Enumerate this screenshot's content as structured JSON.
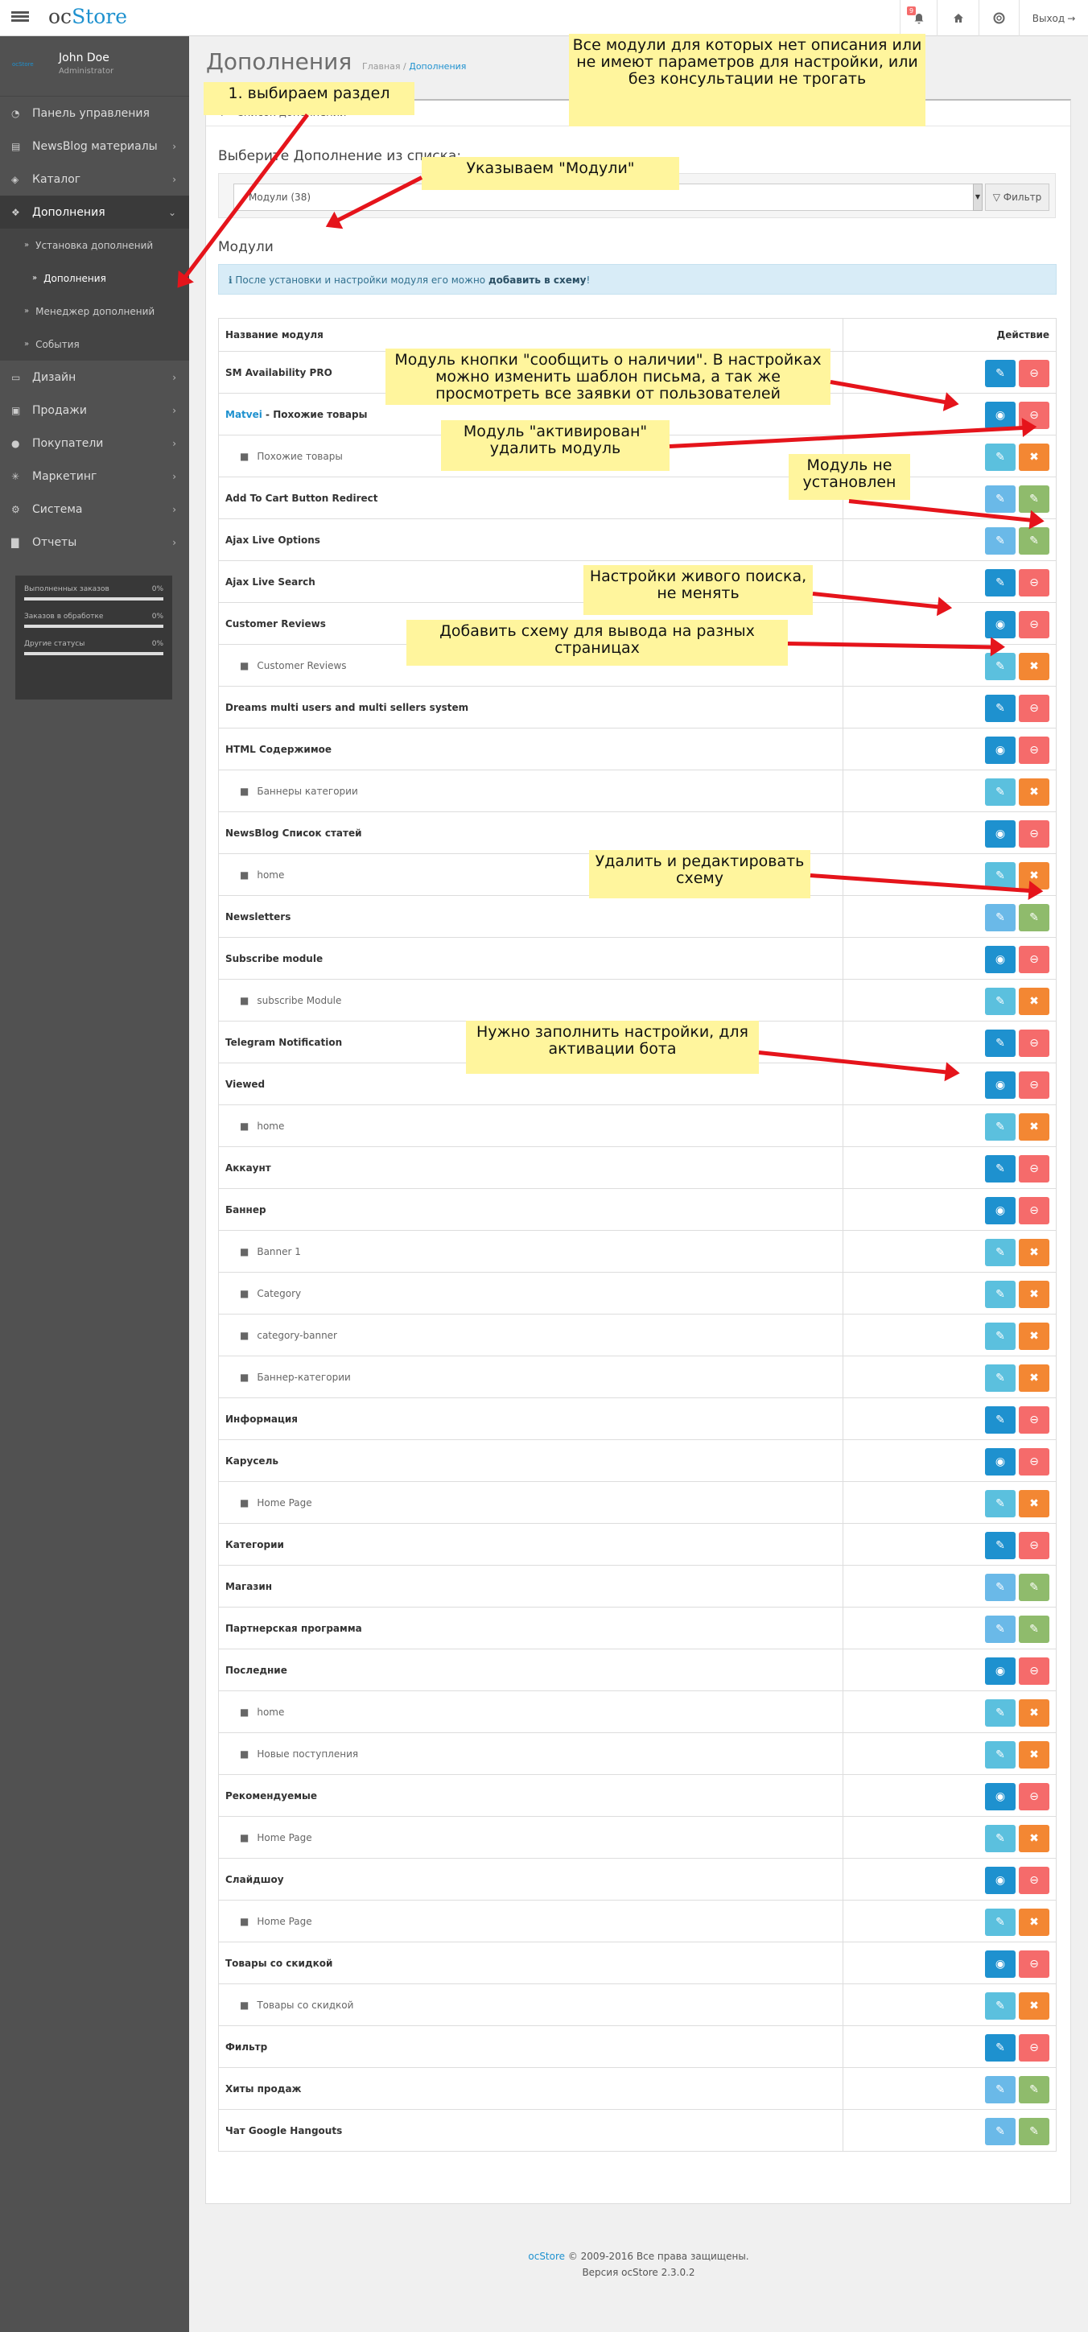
{
  "header": {
    "logo_prefix": "oc",
    "logo_name": "Store",
    "bell_badge": "9",
    "logout_label": "Выход"
  },
  "profile": {
    "avatar_text": "ocStore",
    "name": "John Doe",
    "role": "Administrator"
  },
  "sidebar": {
    "items": [
      {
        "label": "Панель управления",
        "icon": "dashboard-icon"
      },
      {
        "label": "NewsBlog материалы",
        "icon": "newspaper-icon"
      },
      {
        "label": "Каталог",
        "icon": "tag-icon"
      },
      {
        "label": "Дополнения",
        "icon": "puzzle-icon"
      },
      {
        "label": "Дизайн",
        "icon": "monitor-icon"
      },
      {
        "label": "Продажи",
        "icon": "cart-icon"
      },
      {
        "label": "Покупатели",
        "icon": "user-icon"
      },
      {
        "label": "Маркетинг",
        "icon": "share-icon"
      },
      {
        "label": "Система",
        "icon": "gear-icon"
      },
      {
        "label": "Отчеты",
        "icon": "bar-chart-icon"
      }
    ],
    "subitems": [
      {
        "label": "Установка дополнений"
      },
      {
        "label": "Дополнения"
      },
      {
        "label": "Менеджер дополнений"
      },
      {
        "label": "События"
      }
    ],
    "stats": [
      {
        "label": "Выполненных заказов",
        "value": "0%"
      },
      {
        "label": "Заказов в обработке",
        "value": "0%"
      },
      {
        "label": "Другие статусы",
        "value": "0%"
      }
    ]
  },
  "page": {
    "title": "Дополнения",
    "breadcrumb_home": "Главная",
    "breadcrumb_current": "Дополнения",
    "panel_title": "Список дополнений",
    "choose_label": "Выберите Дополнение из списка:",
    "select_value": "Модули (38)",
    "filter_label": "Фильтр",
    "modules_heading": "Модули",
    "info_text": "После установки и настройки модуля его можно ",
    "info_bold": "добавить в схему",
    "info_end": "!",
    "col_name": "Название модуля",
    "col_action": "Действие"
  },
  "rows": [
    {
      "name": "SM Availability PRO",
      "type": "module",
      "state": "installed-no-status"
    },
    {
      "prefix": "Matvei",
      "name": " - Похожие товары",
      "type": "module",
      "state": "installed"
    },
    {
      "name": "Похожие товары",
      "type": "sub"
    },
    {
      "name": "Add To Cart Button Redirect",
      "type": "module",
      "state": "not-installed"
    },
    {
      "name": "Ajax Live Options",
      "type": "module",
      "state": "not-installed"
    },
    {
      "name": "Ajax Live Search",
      "type": "module",
      "state": "installed-no-status"
    },
    {
      "name": "Customer Reviews",
      "type": "module",
      "state": "installed"
    },
    {
      "name": "Customer Reviews",
      "type": "sub"
    },
    {
      "name": "Dreams multi users and multi sellers system",
      "type": "module",
      "state": "installed-no-status"
    },
    {
      "name": "HTML Содержимое",
      "type": "module",
      "state": "installed"
    },
    {
      "name": "Баннеры категории",
      "type": "sub"
    },
    {
      "name": "NewsBlog Список статей",
      "type": "module",
      "state": "installed"
    },
    {
      "name": "home",
      "type": "sub"
    },
    {
      "name": "Newsletters",
      "type": "module",
      "state": "not-installed"
    },
    {
      "name": "Subscribe module",
      "type": "module",
      "state": "installed"
    },
    {
      "name": "subscribe Module",
      "type": "sub"
    },
    {
      "name": "Telegram Notification",
      "type": "module",
      "state": "installed-no-status"
    },
    {
      "name": "Viewed",
      "type": "module",
      "state": "installed"
    },
    {
      "name": "home",
      "type": "sub"
    },
    {
      "name": "Аккаунт",
      "type": "module",
      "state": "installed-no-status"
    },
    {
      "name": "Баннер",
      "type": "module",
      "state": "installed"
    },
    {
      "name": "Banner 1",
      "type": "sub"
    },
    {
      "name": "Category",
      "type": "sub"
    },
    {
      "name": "category-banner",
      "type": "sub"
    },
    {
      "name": "Баннер-категории",
      "type": "sub"
    },
    {
      "name": "Информация",
      "type": "module",
      "state": "installed-no-status"
    },
    {
      "name": "Карусель",
      "type": "module",
      "state": "installed"
    },
    {
      "name": "Home Page",
      "type": "sub"
    },
    {
      "name": "Категории",
      "type": "module",
      "state": "installed-no-status"
    },
    {
      "name": "Магазин",
      "type": "module",
      "state": "not-installed"
    },
    {
      "name": "Партнерская программа",
      "type": "module",
      "state": "not-installed"
    },
    {
      "name": "Последние",
      "type": "module",
      "state": "installed"
    },
    {
      "name": "home",
      "type": "sub"
    },
    {
      "name": "Новые поступления",
      "type": "sub"
    },
    {
      "name": "Рекомендуемые",
      "type": "module",
      "state": "installed"
    },
    {
      "name": "Home Page",
      "type": "sub"
    },
    {
      "name": "Слайдшоу",
      "type": "module",
      "state": "installed"
    },
    {
      "name": "Home Page",
      "type": "sub"
    },
    {
      "name": "Товары со скидкой",
      "type": "module",
      "state": "installed"
    },
    {
      "name": "Товары со скидкой",
      "type": "sub"
    },
    {
      "name": "Фильтр",
      "type": "module",
      "state": "installed-no-status"
    },
    {
      "name": "Хиты продаж",
      "type": "module",
      "state": "not-installed"
    },
    {
      "name": "Чат Google Hangouts",
      "type": "module",
      "state": "not-installed"
    }
  ],
  "notes": [
    {
      "text": "1. выбираем раздел"
    },
    {
      "text": "Все модули для которых нет описания или не имеют параметров для настройки, или без консультации не трогать"
    },
    {
      "text": "Указываем \"Модули\""
    },
    {
      "text": "Модуль кнопки \"сообщить о наличии\". В настройках можно изменить шаблон письма, а так же просмотреть все заявки от пользователей"
    },
    {
      "text": "Модуль \"активирован\" удалить модуль"
    },
    {
      "text": "Модуль не установлен"
    },
    {
      "text": "Настройки живого поиска, не менять"
    },
    {
      "text": "Добавить схему для вывода на разных страницах"
    },
    {
      "text": "Удалить и редактировать схему"
    },
    {
      "text": "Нужно заполнить настройки, для активации бота"
    }
  ],
  "footer": {
    "brand": "ocStore",
    "copyright": " © 2009-2016 Все права защищены.",
    "version": "Версия ocStore 2.3.0.2"
  },
  "colors": {
    "accent": "#1e91cf",
    "danger": "#f56b6b",
    "warning": "#f38733",
    "success": "#8fbb6c",
    "info": "#5bc0de",
    "sidebar": "#515151",
    "note": "#fff59d",
    "arrow": "#e5141b"
  }
}
